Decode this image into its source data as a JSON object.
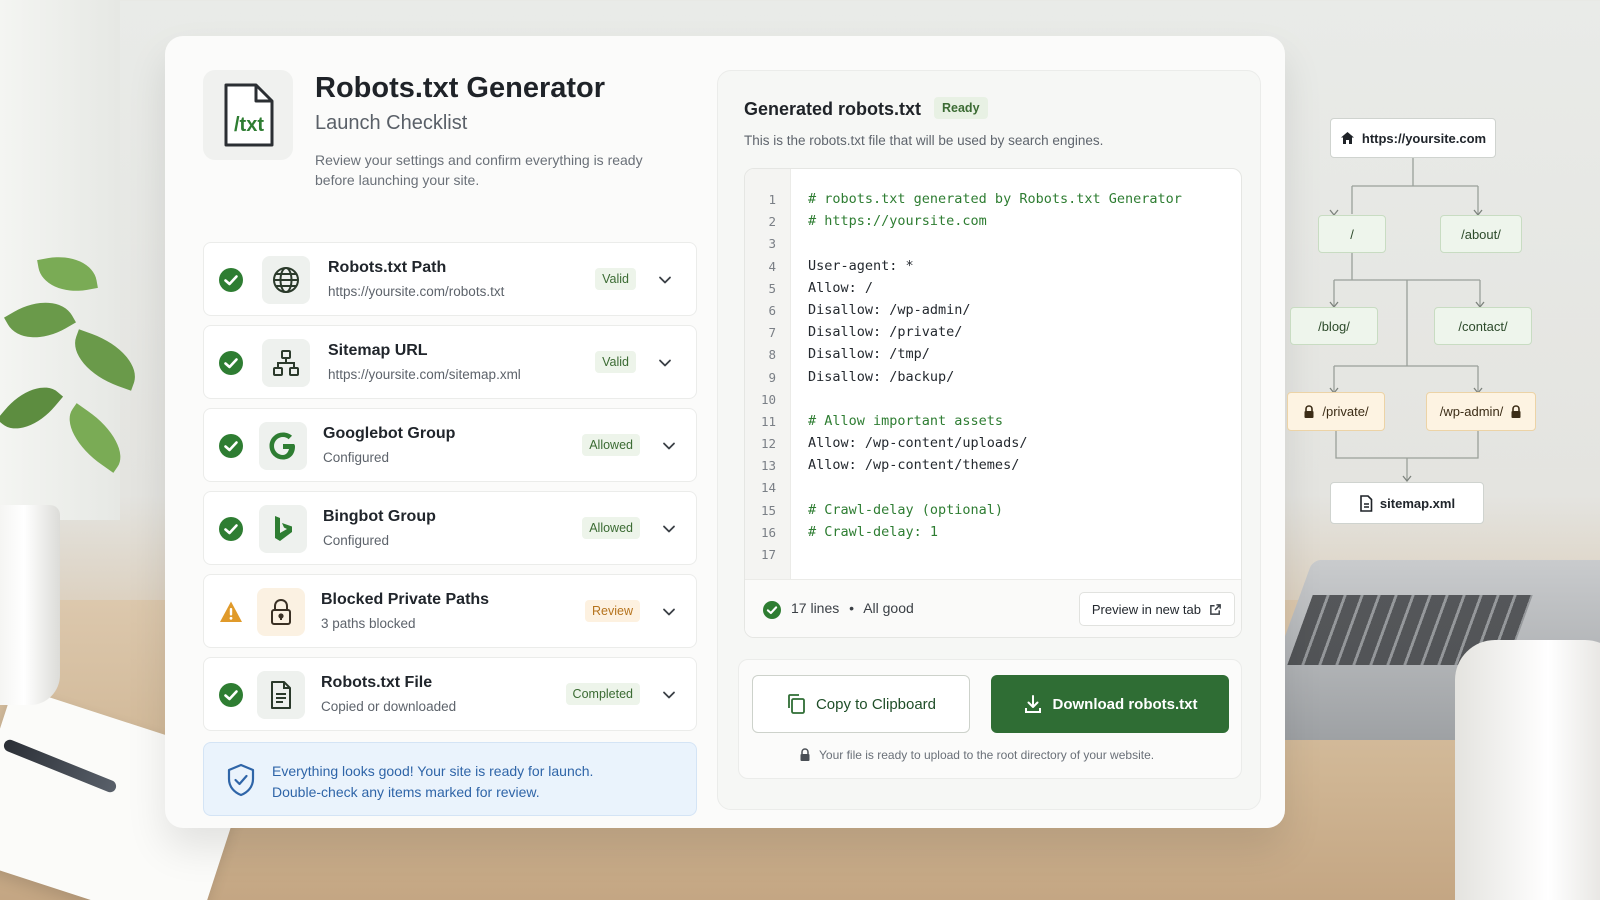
{
  "header": {
    "file_icon_text": "/txt",
    "title": "Robots.txt Generator",
    "subtitle": "Launch Checklist",
    "description": "Review your settings and confirm everything is ready before launching your site."
  },
  "checklist": [
    {
      "title": "Robots.txt Path",
      "subtitle": "https://yoursite.com/robots.txt",
      "badge": "Valid",
      "status": "ok",
      "icon": "globe-icon"
    },
    {
      "title": "Sitemap URL",
      "subtitle": "https://yoursite.com/sitemap.xml",
      "badge": "Valid",
      "status": "ok",
      "icon": "sitemap-icon"
    },
    {
      "title": "Googlebot Group",
      "subtitle": "Configured",
      "badge": "Allowed",
      "status": "ok",
      "icon": "google-icon"
    },
    {
      "title": "Bingbot Group",
      "subtitle": "Configured",
      "badge": "Allowed",
      "status": "ok",
      "icon": "bing-icon"
    },
    {
      "title": "Blocked Private Paths",
      "subtitle": "3 paths blocked",
      "badge": "Review",
      "status": "warn",
      "icon": "lock-icon"
    },
    {
      "title": "Robots.txt File",
      "subtitle": "Copied or downloaded",
      "badge": "Completed",
      "status": "ok",
      "icon": "document-icon"
    }
  ],
  "note": {
    "line1": "Everything looks good! Your site is ready for launch.",
    "line2": "Double-check any items marked for review."
  },
  "generated": {
    "title": "Generated robots.txt",
    "status_badge": "Ready",
    "description": "This is the robots.txt file that will be used by search engines.",
    "lines": [
      {
        "n": "1",
        "text": "# robots.txt generated by Robots.txt Generator",
        "comment": true
      },
      {
        "n": "2",
        "text": "# https://yoursite.com",
        "comment": true
      },
      {
        "n": "3",
        "text": "",
        "comment": false
      },
      {
        "n": "4",
        "text": "User-agent: *",
        "comment": false
      },
      {
        "n": "5",
        "text": "Allow: /",
        "comment": false
      },
      {
        "n": "6",
        "text": "Disallow: /wp-admin/",
        "comment": false
      },
      {
        "n": "7",
        "text": "Disallow: /private/",
        "comment": false
      },
      {
        "n": "8",
        "text": "Disallow: /tmp/",
        "comment": false
      },
      {
        "n": "9",
        "text": "Disallow: /backup/",
        "comment": false
      },
      {
        "n": "10",
        "text": "",
        "comment": false
      },
      {
        "n": "11",
        "text": "# Allow important assets",
        "comment": true
      },
      {
        "n": "12",
        "text": "Allow: /wp-content/uploads/",
        "comment": false
      },
      {
        "n": "13",
        "text": "Allow: /wp-content/themes/",
        "comment": false
      },
      {
        "n": "14",
        "text": "",
        "comment": false
      },
      {
        "n": "15",
        "text": "# Crawl-delay (optional)",
        "comment": true
      },
      {
        "n": "16",
        "text": "# Crawl-delay: 1",
        "comment": true
      },
      {
        "n": "17",
        "text": "",
        "comment": false
      }
    ],
    "footer_lines": "17 lines",
    "footer_sep": "•",
    "footer_status": "All good",
    "preview_label": "Preview in new tab"
  },
  "actions": {
    "copy_label": "Copy to Clipboard",
    "download_label": "Download robots.txt",
    "note": "Your file is ready to upload to the root directory of your website."
  },
  "tree": {
    "root": "https://yoursite.com",
    "slash": "/",
    "about": "/about/",
    "blog": "/blog/",
    "contact": "/contact/",
    "private": "/private/",
    "wpadmin": "/wp-admin/",
    "sitemap": "sitemap.xml"
  },
  "colors": {
    "accent": "#2f6d34",
    "ok": "#2e7d32",
    "warn": "#e09a2a",
    "info": "#2f65a8"
  }
}
